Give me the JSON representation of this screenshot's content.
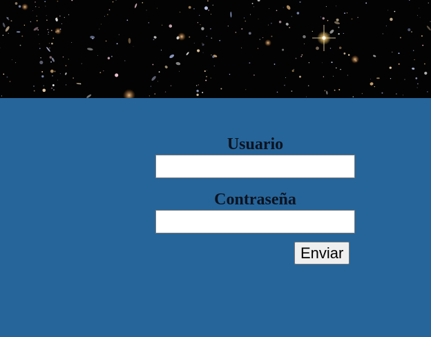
{
  "banner": {
    "image_name": "deep-field-starfield-image"
  },
  "form": {
    "username_label": "Usuario",
    "username_value": "",
    "password_label": "Contraseña",
    "password_value": "",
    "submit_label": "Enviar"
  },
  "colors": {
    "background": "#26659a",
    "banner_background": "#030303",
    "label_text": "#0c1320"
  }
}
